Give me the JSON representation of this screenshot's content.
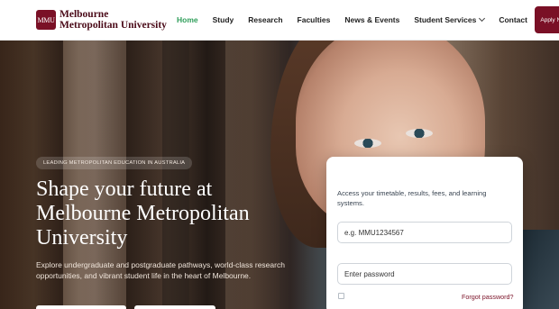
{
  "brand": {
    "badge": "MMU",
    "name": "Melbourne Metropolitan University",
    "color": "#7a1026"
  },
  "nav": {
    "items": [
      {
        "label": "Home",
        "active": true
      },
      {
        "label": "Study"
      },
      {
        "label": "Research"
      },
      {
        "label": "Faculties"
      },
      {
        "label": "News & Events"
      },
      {
        "label": "Student Services",
        "has_dropdown": true
      },
      {
        "label": "Contact"
      }
    ],
    "apply_label": "Apply Now",
    "active_color": "#2f9e5a"
  },
  "hero": {
    "eyebrow": "LEADING METROPOLITAN EDUCATION IN AUSTRALIA",
    "title": "Shape your future at Melbourne Metropolitan University",
    "description": "Explore undergraduate and postgraduate pathways, world-class research opportunities, and vibrant student life in the heart of Melbourne."
  },
  "login": {
    "intro": "Access your timetable, results, fees, and learning systems.",
    "id_placeholder": "e.g. MMU1234567",
    "password_placeholder": "Enter password",
    "forgot_label": "Forgot password?"
  }
}
